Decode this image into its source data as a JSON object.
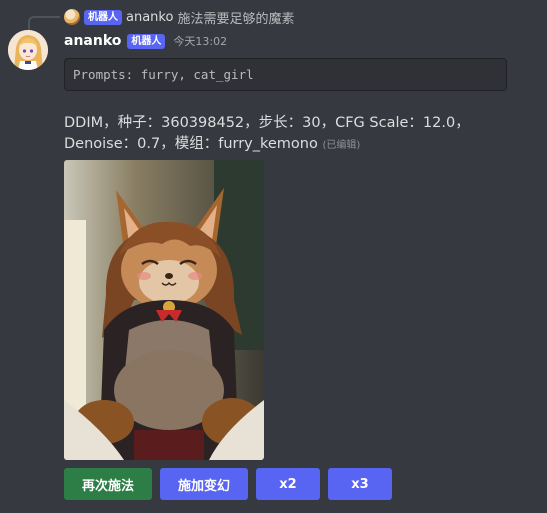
{
  "reply": {
    "badge": "机器人",
    "username": "ananko",
    "text": "施法需要足够的魔素"
  },
  "message": {
    "username": "ananko",
    "badge": "机器人",
    "timestamp": "今天13:02",
    "code": "Prompts: furry, cat_girl",
    "text": "DDIM，种子：360398452，步长：30，CFG Scale：12.0，Denoise：0.7，模组：furry_kemono",
    "edited": "(已编辑)"
  },
  "buttons": [
    {
      "label": "再次施法",
      "color": "#2d7d46"
    },
    {
      "label": "施加变幻",
      "color": "#5865f2"
    },
    {
      "label": "x2",
      "color": "#5865f2"
    },
    {
      "label": "x3",
      "color": "#5865f2"
    }
  ],
  "colors": {
    "background": "#36393f",
    "badge": "#5865f2",
    "code_bg": "#2f3136"
  },
  "icons": {
    "reply_avatar": "reply-avatar-icon",
    "avatar": "anime-girl-avatar"
  }
}
